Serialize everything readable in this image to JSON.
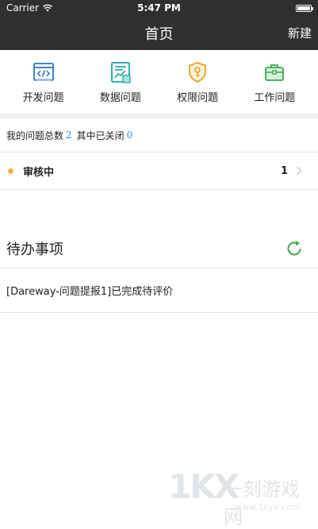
{
  "status_bar": {
    "carrier": "Carrier",
    "time": "5:47 PM",
    "battery_level": 1.0
  },
  "nav": {
    "title": "首页",
    "action_label": "新建"
  },
  "categories": [
    {
      "label": "开发问题",
      "icon": "code-window-icon",
      "color": "#2f74c7"
    },
    {
      "label": "数据问题",
      "icon": "data-chart-icon",
      "color": "#1aa3a3"
    },
    {
      "label": "权限问题",
      "icon": "key-shield-icon",
      "color": "#e0a21f"
    },
    {
      "label": "工作问题",
      "icon": "briefcase-icon",
      "color": "#3aa84a"
    }
  ],
  "summary": {
    "total_label": "我的问题总数",
    "total_value": "2",
    "closed_label": "其中已关闭",
    "closed_value": "0"
  },
  "status_rows": [
    {
      "label": "审核中",
      "count": "1",
      "dot_color": "#f0b44a"
    }
  ],
  "todo": {
    "title": "待办事项",
    "items": [
      {
        "text": "[Dareway-问题提报1]已完成待评价"
      }
    ]
  },
  "watermark": {
    "mark": "1KX",
    "cn": "一刻游戏网",
    "url": "www.1kyx.com"
  }
}
